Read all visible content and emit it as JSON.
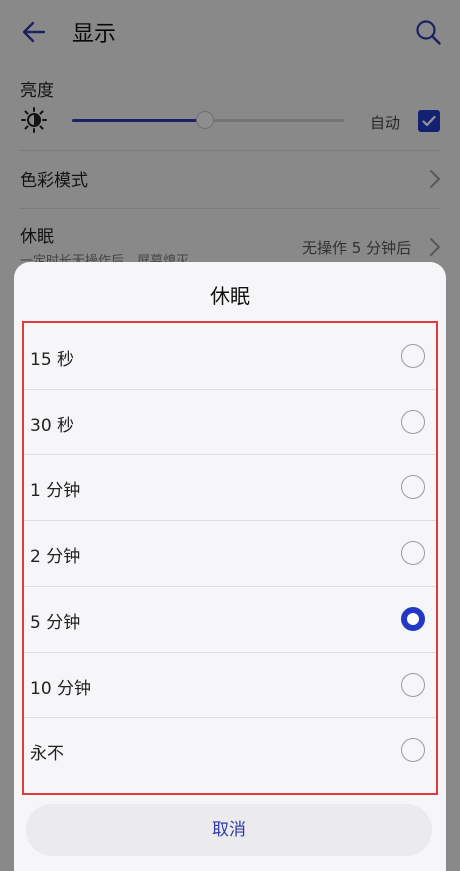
{
  "header": {
    "title": "显示"
  },
  "brightness": {
    "label": "亮度",
    "auto_label": "自动",
    "level": 0.49,
    "auto_checked": true
  },
  "color_mode": {
    "label": "色彩模式"
  },
  "sleep": {
    "label": "休眠",
    "description": "一定时长无操作后，屏幕熄灭",
    "value": "无操作 5 分钟后"
  },
  "dialog": {
    "title": "休眠",
    "options": [
      {
        "label": "15 秒",
        "selected": false
      },
      {
        "label": "30 秒",
        "selected": false
      },
      {
        "label": "1 分钟",
        "selected": false
      },
      {
        "label": "2 分钟",
        "selected": false
      },
      {
        "label": "5 分钟",
        "selected": true
      },
      {
        "label": "10 分钟",
        "selected": false
      },
      {
        "label": "永不",
        "selected": false
      }
    ],
    "cancel_label": "取消"
  },
  "colors": {
    "accent": "#2338c4",
    "highlight_frame": "#e2393d"
  }
}
